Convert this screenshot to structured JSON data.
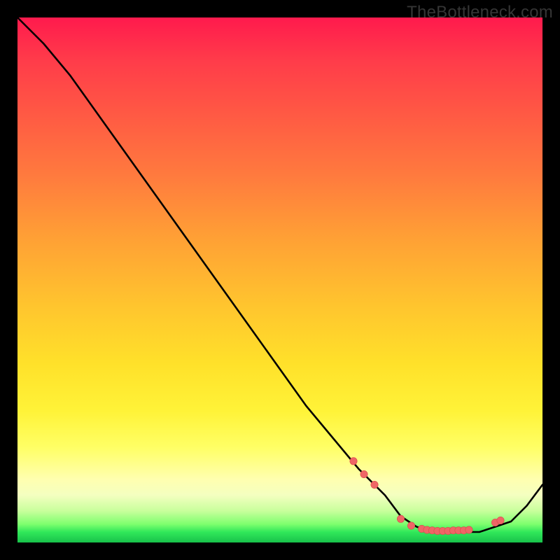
{
  "watermark": "TheBottleneck.com",
  "chart_data": {
    "type": "line",
    "title": "",
    "xlabel": "",
    "ylabel": "",
    "xlim": [
      0,
      100
    ],
    "ylim": [
      0,
      100
    ],
    "series": [
      {
        "name": "bottleneck-curve",
        "x": [
          0,
          5,
          10,
          15,
          20,
          25,
          30,
          35,
          40,
          45,
          50,
          55,
          60,
          65,
          70,
          73,
          76,
          79,
          82,
          85,
          88,
          91,
          94,
          97,
          100
        ],
        "y": [
          100,
          95,
          89,
          82,
          75,
          68,
          61,
          54,
          47,
          40,
          33,
          26,
          20,
          14,
          9,
          5,
          3,
          2,
          2,
          2,
          2,
          3,
          4,
          7,
          11
        ]
      }
    ],
    "markers": {
      "name": "data-points",
      "x": [
        64,
        66,
        68,
        73,
        75,
        77,
        78,
        79,
        80,
        81,
        82,
        83,
        84,
        85,
        86,
        91,
        92
      ],
      "y": [
        15.5,
        13,
        11,
        4.5,
        3.2,
        2.6,
        2.4,
        2.3,
        2.2,
        2.2,
        2.2,
        2.3,
        2.3,
        2.3,
        2.4,
        3.8,
        4.2
      ]
    },
    "gradient_stops": [
      {
        "pos": 0,
        "color": "#ff1a4d"
      },
      {
        "pos": 30,
        "color": "#ff7a3e"
      },
      {
        "pos": 55,
        "color": "#ffc52e"
      },
      {
        "pos": 82,
        "color": "#ffff66"
      },
      {
        "pos": 96,
        "color": "#7eff6e"
      },
      {
        "pos": 100,
        "color": "#18c24a"
      }
    ]
  }
}
